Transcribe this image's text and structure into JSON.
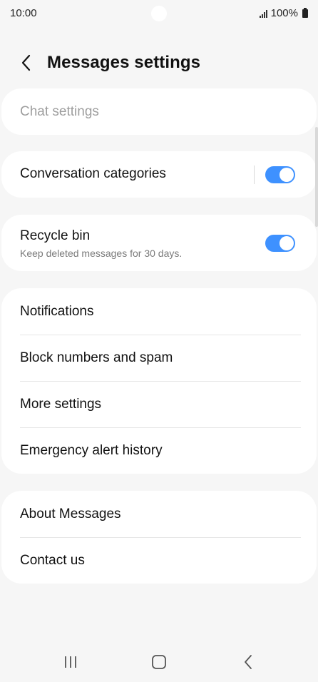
{
  "status_bar": {
    "time": "10:00",
    "battery": "100%"
  },
  "header": {
    "title": "Messages settings"
  },
  "sections": {
    "chat": {
      "label": "Chat settings"
    },
    "conversation_categories": {
      "label": "Conversation categories",
      "enabled": true
    },
    "recycle_bin": {
      "label": "Recycle bin",
      "subtitle": "Keep deleted messages for 30 days.",
      "enabled": true
    },
    "settings_list": [
      {
        "label": "Notifications"
      },
      {
        "label": "Block numbers and spam"
      },
      {
        "label": "More settings"
      },
      {
        "label": "Emergency alert history"
      }
    ],
    "about_list": [
      {
        "label": "About Messages"
      },
      {
        "label": "Contact us"
      }
    ]
  },
  "colors": {
    "accent": "#3e91ff",
    "background": "#f6f6f6",
    "card": "#ffffff",
    "disabled_text": "#9e9e9e"
  },
  "icons": {
    "back": "back-arrow-icon",
    "signal": "signal-icon",
    "battery": "battery-icon",
    "nav_recents": "recent-apps-icon",
    "nav_home": "home-icon",
    "nav_back": "nav-back-icon"
  }
}
